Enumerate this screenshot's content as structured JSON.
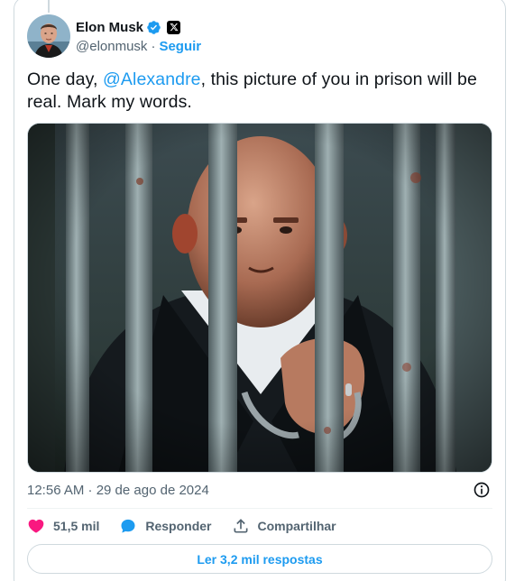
{
  "author": {
    "display_name": "Elon Musk",
    "handle": "@elonmusk",
    "separator": "·",
    "follow_label": "Seguir"
  },
  "tweet": {
    "text_before": "One day, ",
    "mention": "@Alexandre",
    "text_after": ", this picture of you in prison will be real. Mark my words."
  },
  "timestamp": "12:56 AM · 29 de ago de 2024",
  "actions": {
    "like_count": "51,5 mil",
    "reply_label": "Responder",
    "share_label": "Compartilhar"
  },
  "read_replies_label": "Ler 3,2 mil respostas",
  "colors": {
    "accent": "#1d9bf0",
    "like": "#f91880",
    "secondary_text": "#536471"
  },
  "icons": {
    "verified": "verified-badge-icon",
    "x_logo": "x-logo-icon",
    "info": "info-icon",
    "like": "heart-icon",
    "reply": "speech-bubble-icon",
    "share": "share-upload-icon"
  }
}
